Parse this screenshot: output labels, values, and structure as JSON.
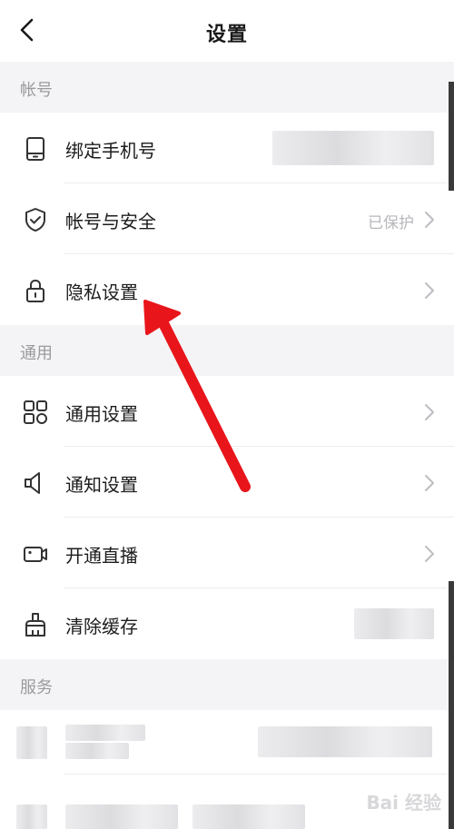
{
  "header": {
    "title": "设置"
  },
  "sections": [
    {
      "title": "帐号",
      "items": [
        {
          "label": "绑定手机号",
          "value": "",
          "icon": "phone-icon"
        },
        {
          "label": "帐号与安全",
          "value": "已保护",
          "icon": "shield-icon"
        },
        {
          "label": "隐私设置",
          "value": "",
          "icon": "lock-icon"
        }
      ]
    },
    {
      "title": "通用",
      "items": [
        {
          "label": "通用设置",
          "value": "",
          "icon": "grid-icon"
        },
        {
          "label": "通知设置",
          "value": "",
          "icon": "speaker-icon"
        },
        {
          "label": "开通直播",
          "value": "",
          "icon": "video-camera-icon"
        },
        {
          "label": "清除缓存",
          "value": "",
          "icon": "broom-icon"
        }
      ]
    },
    {
      "title": "服务",
      "items": []
    }
  ],
  "watermark": "Bai 经验",
  "colors": {
    "annotation_arrow": "#e8151b",
    "section_text": "#9a9a9f"
  }
}
